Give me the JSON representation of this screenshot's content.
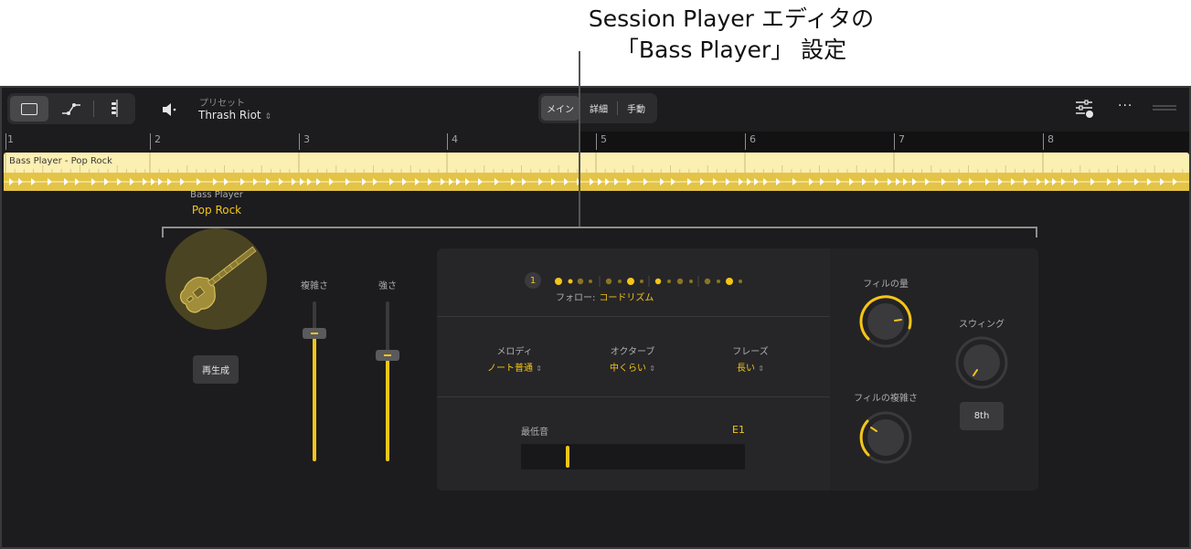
{
  "callout": {
    "line1": "Session Player エディタの",
    "line2": "「Bass Player」 設定"
  },
  "toolbar": {
    "preset_label": "プリセット",
    "preset_value": "Thrash Riot",
    "tabs": [
      {
        "label": "メイン",
        "active": true
      },
      {
        "label": "詳細"
      },
      {
        "label": "手動"
      }
    ]
  },
  "ruler": {
    "bars": [
      "1",
      "2",
      "3",
      "4",
      "5",
      "6",
      "7",
      "8"
    ]
  },
  "region": {
    "name": "Bass Player - Pop Rock"
  },
  "player": {
    "label": "Bass Player",
    "style": "Pop Rock",
    "regenerate_label": "再生成"
  },
  "sliders": {
    "complexity": {
      "label": "複雑さ",
      "value": 0.8
    },
    "intensity": {
      "label": "強さ",
      "value": 0.66
    }
  },
  "pattern": {
    "beat": "1",
    "follow_label": "フォロー:",
    "follow_value": "コードリズム"
  },
  "params": {
    "melody": {
      "label": "メロディ",
      "value": "ノート普通"
    },
    "octave": {
      "label": "オクターブ",
      "value": "中くらい"
    },
    "phrase": {
      "label": "フレーズ",
      "value": "長い"
    }
  },
  "lowest_note": {
    "label": "最低音",
    "value": "E1"
  },
  "knobs": {
    "fill_amount": {
      "label": "フィルの量"
    },
    "fill_complexity": {
      "label": "フィルの複雑さ"
    },
    "swing": {
      "label": "スウィング",
      "button": "8th"
    }
  },
  "colors": {
    "accent": "#f5c518",
    "region_top": "#fbefb2",
    "region_bottom": "#e3c447",
    "background": "#1c1c1e"
  }
}
